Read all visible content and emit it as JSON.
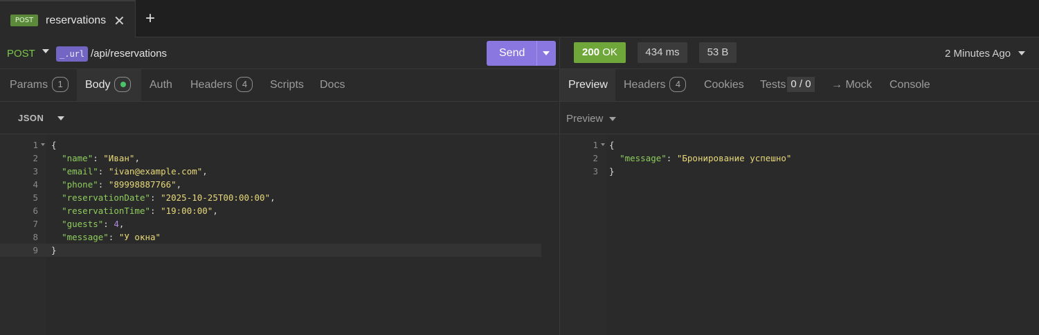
{
  "tab": {
    "method_badge": "POST",
    "name": "reservations",
    "close_glyph": "✕",
    "add_glyph": "+"
  },
  "request": {
    "method": "POST",
    "url_variable": "_.url",
    "url_path": "/api/reservations",
    "send_label": "Send",
    "tabs": [
      {
        "label": "Params",
        "count": "1"
      },
      {
        "label": "Body"
      },
      {
        "label": "Auth"
      },
      {
        "label": "Headers",
        "count": "4"
      },
      {
        "label": "Scripts"
      },
      {
        "label": "Docs"
      }
    ],
    "body_type": "JSON",
    "body_lines": [
      {
        "no": "1"
      },
      {
        "no": "2"
      },
      {
        "no": "3"
      },
      {
        "no": "4"
      },
      {
        "no": "5"
      },
      {
        "no": "6"
      },
      {
        "no": "7"
      },
      {
        "no": "8"
      },
      {
        "no": "9"
      }
    ],
    "body": {
      "open": "{",
      "close": "}",
      "fields": [
        {
          "key": "\"name\"",
          "value": "\"Иван\"",
          "sep": ","
        },
        {
          "key": "\"email\"",
          "value": "\"ivan@example.com\"",
          "sep": ","
        },
        {
          "key": "\"phone\"",
          "value": "\"89998887766\"",
          "sep": ","
        },
        {
          "key": "\"reservationDate\"",
          "value": "\"2025-10-25T00:00:00\"",
          "sep": ","
        },
        {
          "key": "\"reservationTime\"",
          "value": "\"19:00:00\"",
          "sep": ","
        },
        {
          "key": "\"guests\"",
          "value": "4",
          "sep": ","
        },
        {
          "key": "\"message\"",
          "value": "\"У окна\"",
          "sep": ""
        }
      ]
    }
  },
  "response": {
    "status_code": "200",
    "status_text": "OK",
    "time": "434 ms",
    "size": "53 B",
    "received": "2 Minutes Ago",
    "tabs": [
      {
        "label": "Preview"
      },
      {
        "label": "Headers",
        "count": "4"
      },
      {
        "label": "Cookies"
      },
      {
        "label": "Tests",
        "count": "0 / 0"
      },
      {
        "label": "→ Mock"
      },
      {
        "label": "Console"
      }
    ],
    "preview_mode": "Preview",
    "body_lines": [
      {
        "no": "1"
      },
      {
        "no": "2"
      },
      {
        "no": "3"
      }
    ],
    "body": {
      "open": "{",
      "close": "}",
      "key": "\"message\"",
      "value": "\"Бронирование успешно\""
    }
  },
  "colors": {
    "accent": "#8a77e0",
    "post": "#7cc64a",
    "status_ok": "#6fa73a",
    "json_key": "#8ecd5e",
    "json_string": "#e8d97a",
    "json_number": "#b08ae0"
  }
}
